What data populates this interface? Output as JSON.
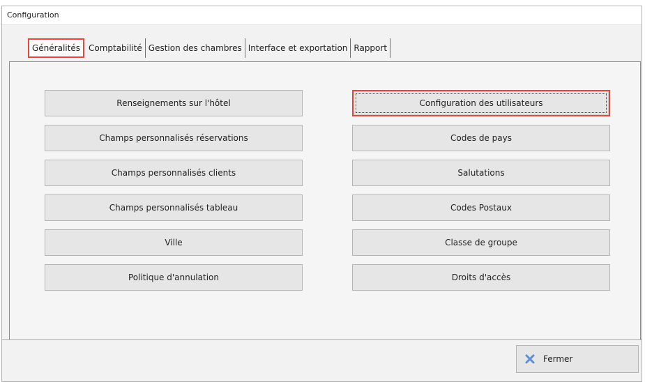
{
  "window": {
    "title": "Configuration"
  },
  "tabs": [
    {
      "label": "Généralités",
      "active": true
    },
    {
      "label": "Comptabilité",
      "active": false
    },
    {
      "label": "Gestion des chambres",
      "active": false
    },
    {
      "label": "Interface et exportation",
      "active": false
    },
    {
      "label": "Rapport",
      "active": false
    }
  ],
  "left_buttons": [
    {
      "label": "Renseignements sur l'hôtel"
    },
    {
      "label": "Champs personnalisés réservations"
    },
    {
      "label": "Champs personnalisés clients"
    },
    {
      "label": "Champs personnalisés tableau"
    },
    {
      "label": "Ville"
    },
    {
      "label": "Politique d'annulation"
    }
  ],
  "right_buttons": [
    {
      "label": "Configuration des utilisateurs",
      "highlighted": true
    },
    {
      "label": "Codes de pays"
    },
    {
      "label": "Salutations"
    },
    {
      "label": "Codes Postaux"
    },
    {
      "label": "Classe de groupe"
    },
    {
      "label": "Droits d'accès"
    }
  ],
  "footer": {
    "close_label": "Fermer",
    "close_icon": "close-x-icon"
  },
  "colors": {
    "highlight": "#e8453c",
    "close_icon": "#5b8fd6"
  }
}
